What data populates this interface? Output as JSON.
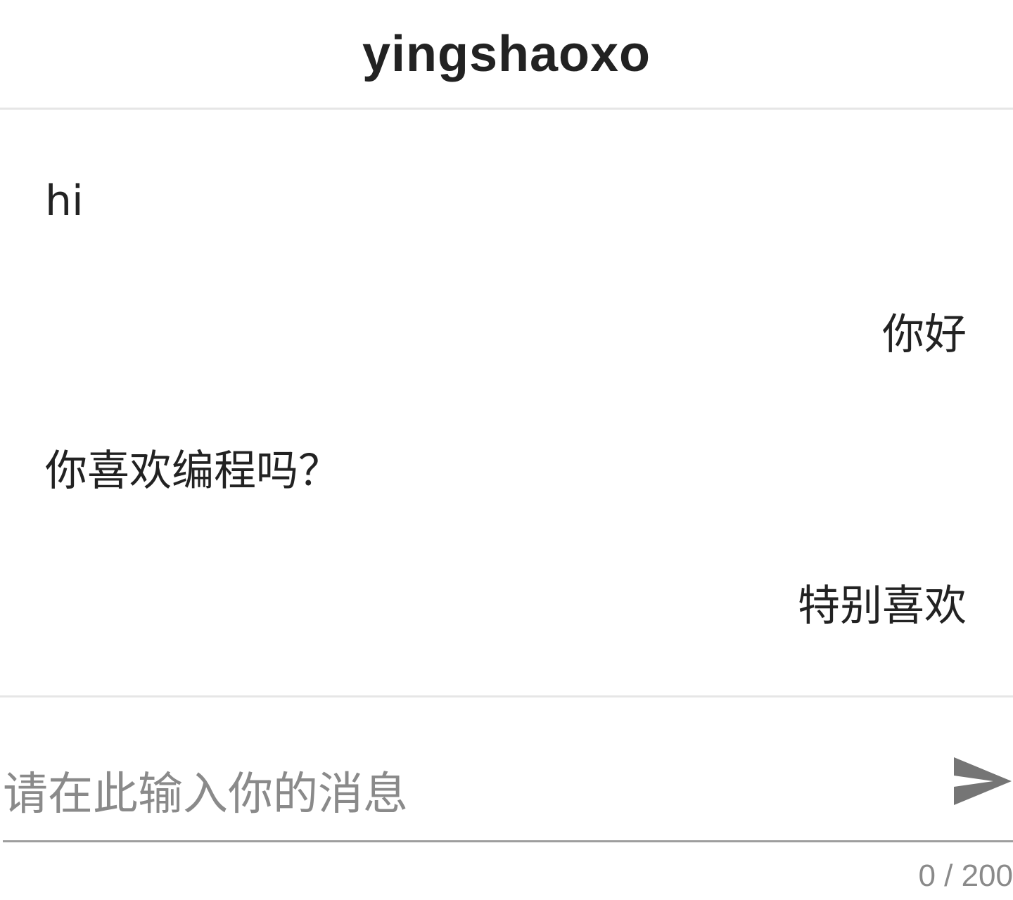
{
  "header": {
    "title": "yingshaoxo"
  },
  "messages": [
    {
      "side": "left",
      "text": "hi"
    },
    {
      "side": "right",
      "text": "你好"
    },
    {
      "side": "left",
      "text": "你喜欢编程吗？"
    },
    {
      "side": "right",
      "text": "特别喜欢"
    }
  ],
  "composer": {
    "placeholder": "请在此输入你的消息",
    "value": "",
    "counter": "0 / 200",
    "send_icon": "send-icon"
  },
  "colors": {
    "text": "#222222",
    "placeholder": "#8a8a8a",
    "divider": "#e6e6e6",
    "underline": "#9e9e9e",
    "send_icon": "#757575"
  }
}
